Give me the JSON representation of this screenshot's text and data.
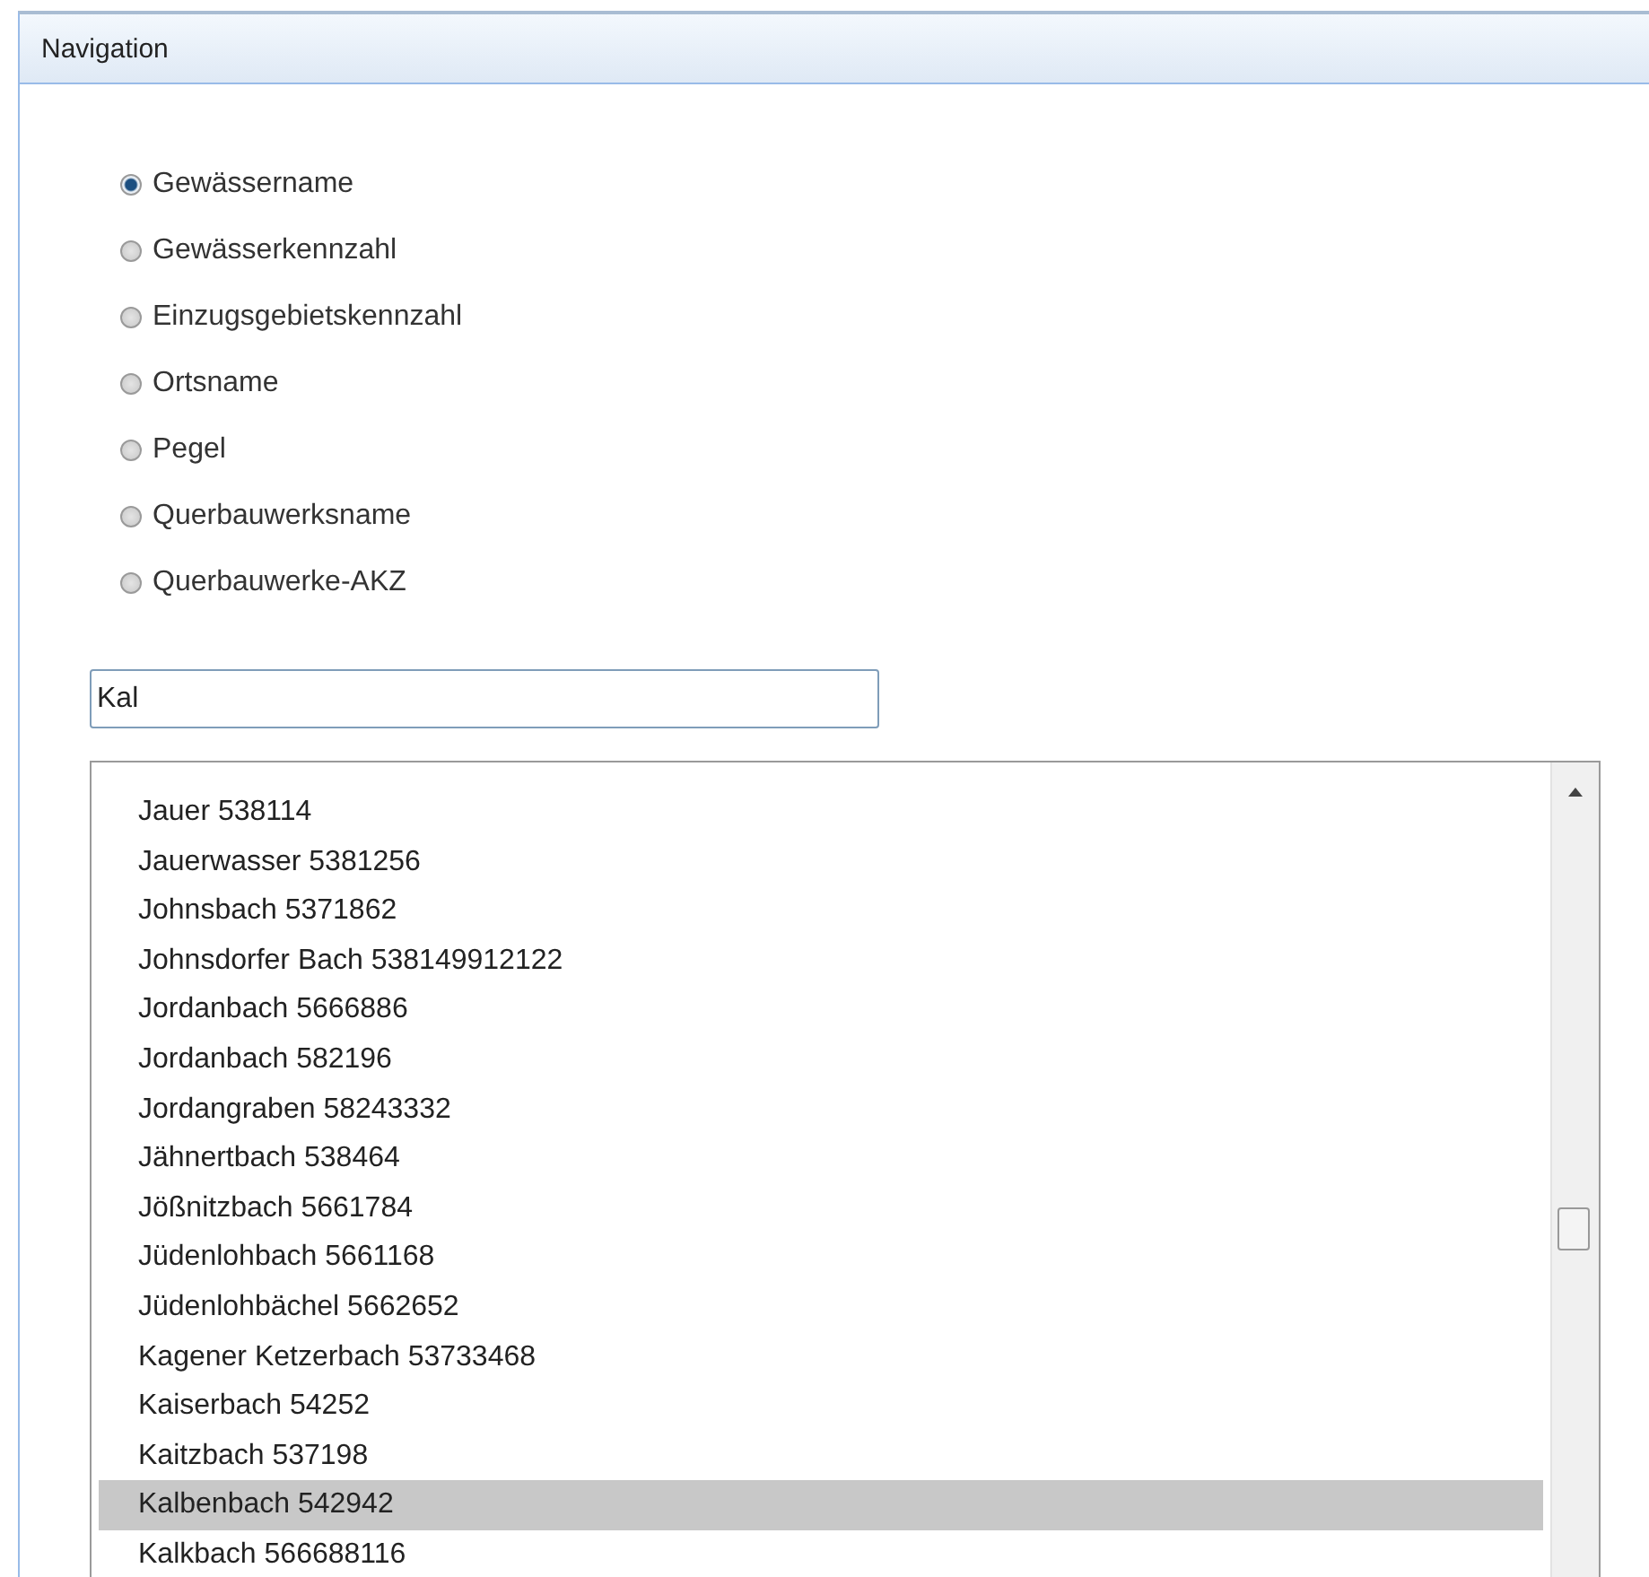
{
  "panel": {
    "title": "Navigation"
  },
  "search_modes": [
    {
      "label": "Gewässername",
      "selected": true
    },
    {
      "label": "Gewässerkennzahl",
      "selected": false
    },
    {
      "label": "Einzugsgebietskennzahl",
      "selected": false
    },
    {
      "label": "Ortsname",
      "selected": false
    },
    {
      "label": "Pegel",
      "selected": false
    },
    {
      "label": "Querbauwerksname",
      "selected": false
    },
    {
      "label": "Querbauwerke-AKZ",
      "selected": false
    }
  ],
  "search": {
    "value": "Kal"
  },
  "results": [
    {
      "label": "Jauer 538114",
      "selected": false
    },
    {
      "label": "Jauerwasser 5381256",
      "selected": false
    },
    {
      "label": "Johnsbach 5371862",
      "selected": false
    },
    {
      "label": "Johnsdorfer Bach 538149912122",
      "selected": false
    },
    {
      "label": "Jordanbach 5666886",
      "selected": false
    },
    {
      "label": "Jordanbach 582196",
      "selected": false
    },
    {
      "label": "Jordangraben 58243332",
      "selected": false
    },
    {
      "label": "Jähnertbach 538464",
      "selected": false
    },
    {
      "label": "Jößnitzbach 5661784",
      "selected": false
    },
    {
      "label": "Jüdenlohbach 5661168",
      "selected": false
    },
    {
      "label": "Jüdenlohbächel 5662652",
      "selected": false
    },
    {
      "label": "Kagener Ketzerbach 53733468",
      "selected": false
    },
    {
      "label": "Kaiserbach 54252",
      "selected": false
    },
    {
      "label": "Kaitzbach 537198",
      "selected": false
    },
    {
      "label": "Kalbenbach 542942",
      "selected": true
    },
    {
      "label": "Kalkbach 566688116",
      "selected": false
    }
  ]
}
